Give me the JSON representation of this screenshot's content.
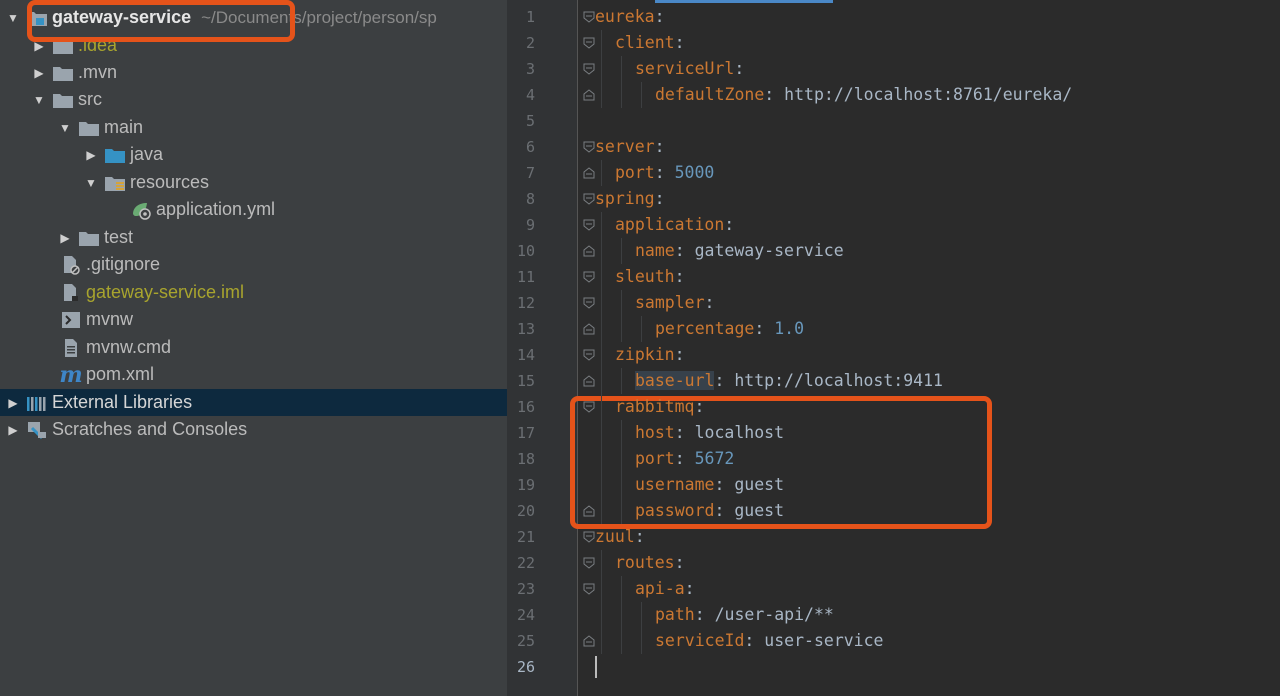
{
  "project_tree": {
    "root": {
      "label": "gateway-service",
      "path": "~/Documents/project/person/sp"
    },
    "items": [
      {
        "label": ".idea"
      },
      {
        "label": ".mvn"
      },
      {
        "label": "src"
      },
      {
        "label": "main"
      },
      {
        "label": "java"
      },
      {
        "label": "resources"
      },
      {
        "label": "application.yml"
      },
      {
        "label": "test"
      },
      {
        "label": ".gitignore"
      },
      {
        "label": "gateway-service.iml"
      },
      {
        "label": "mvnw"
      },
      {
        "label": "mvnw.cmd"
      },
      {
        "label": "pom.xml"
      }
    ],
    "external_libraries": "External Libraries",
    "scratches": "Scratches and Consoles"
  },
  "editor": {
    "line_numbers": [
      "1",
      "2",
      "3",
      "4",
      "5",
      "6",
      "7",
      "8",
      "9",
      "10",
      "11",
      "12",
      "13",
      "14",
      "15",
      "16",
      "17",
      "18",
      "19",
      "20",
      "21",
      "22",
      "23",
      "24",
      "25",
      "26"
    ],
    "lines": [
      {
        "indent": 0,
        "key": "eureka",
        "value": ""
      },
      {
        "indent": 1,
        "key": "client",
        "value": ""
      },
      {
        "indent": 2,
        "key": "serviceUrl",
        "value": ""
      },
      {
        "indent": 3,
        "key": "defaultZone",
        "value": "http://localhost:8761/eureka/"
      },
      {
        "indent": 0,
        "key": "",
        "value": ""
      },
      {
        "indent": 0,
        "key": "server",
        "value": ""
      },
      {
        "indent": 1,
        "key": "port",
        "value": "5000"
      },
      {
        "indent": 0,
        "key": "spring",
        "value": ""
      },
      {
        "indent": 1,
        "key": "application",
        "value": ""
      },
      {
        "indent": 2,
        "key": "name",
        "value": "gateway-service"
      },
      {
        "indent": 1,
        "key": "sleuth",
        "value": ""
      },
      {
        "indent": 2,
        "key": "sampler",
        "value": ""
      },
      {
        "indent": 3,
        "key": "percentage",
        "value": "1.0"
      },
      {
        "indent": 1,
        "key": "zipkin",
        "value": ""
      },
      {
        "indent": 2,
        "key": "base-url",
        "value": "http://localhost:9411"
      },
      {
        "indent": 1,
        "key": "rabbitmq",
        "value": ""
      },
      {
        "indent": 2,
        "key": "host",
        "value": "localhost"
      },
      {
        "indent": 2,
        "key": "port",
        "value": "5672"
      },
      {
        "indent": 2,
        "key": "username",
        "value": "guest"
      },
      {
        "indent": 2,
        "key": "password",
        "value": "guest"
      },
      {
        "indent": 0,
        "key": "zuul",
        "value": ""
      },
      {
        "indent": 1,
        "key": "routes",
        "value": ""
      },
      {
        "indent": 2,
        "key": "api-a",
        "value": ""
      },
      {
        "indent": 3,
        "key": "path",
        "value": "/user-api/**"
      },
      {
        "indent": 3,
        "key": "serviceId",
        "value": "user-service"
      },
      {
        "indent": 0,
        "key": "",
        "value": ""
      }
    ]
  },
  "colors": {
    "yaml_key": "#cc7832",
    "yaml_number": "#6897bb",
    "yaml_text": "#a9b7c6",
    "annotation": "#e5531a",
    "selection": "#0d293e"
  }
}
